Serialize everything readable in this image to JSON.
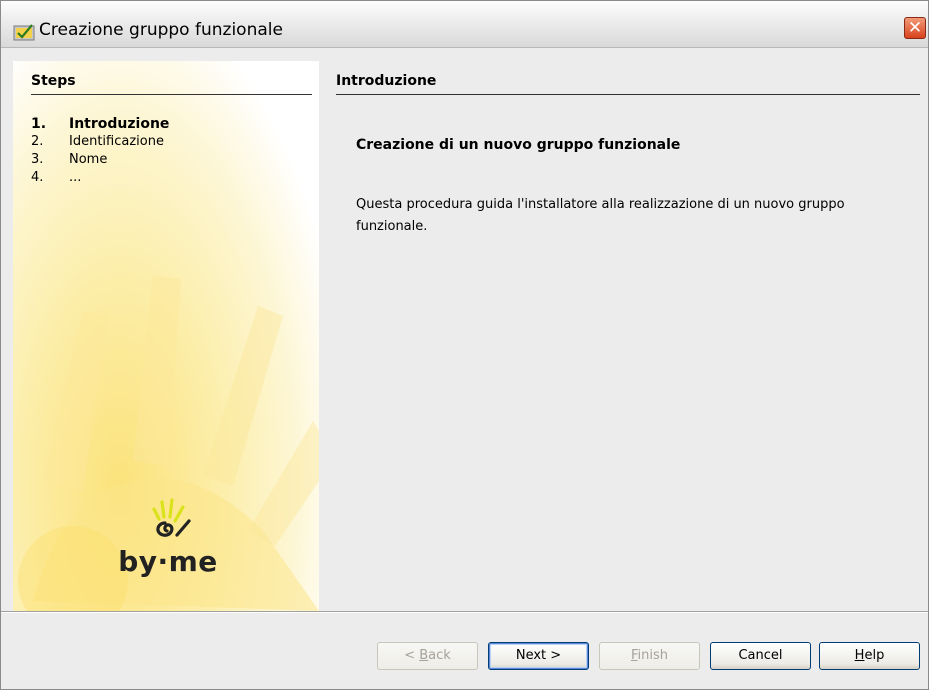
{
  "window": {
    "title": "Creazione gruppo funzionale",
    "close_symbol": "✕"
  },
  "icons": {
    "app": "wizard-app-icon",
    "close": "close-icon",
    "logo": "by-me-logo"
  },
  "steps": {
    "title": "Steps",
    "items": [
      {
        "num": "1.",
        "label": "Introduzione",
        "current": true
      },
      {
        "num": "2.",
        "label": "Identificazione",
        "current": false
      },
      {
        "num": "3.",
        "label": "Nome",
        "current": false
      },
      {
        "num": "4.",
        "label": "...",
        "current": false
      }
    ]
  },
  "logo": {
    "text": "by·me"
  },
  "content": {
    "title": "Introduzione",
    "heading": "Creazione di un nuovo gruppo funzionale",
    "body": "Questa procedura guida l'installatore alla realizzazione di un nuovo gruppo funzionale."
  },
  "buttons": {
    "back": {
      "pre": "< ",
      "mnemonic": "B",
      "rest": "ack"
    },
    "next": {
      "label": "Next >"
    },
    "finish": {
      "pre": "",
      "mnemonic": "F",
      "rest": "inish"
    },
    "cancel": {
      "label": "Cancel"
    },
    "help": {
      "pre": "",
      "mnemonic": "H",
      "rest": "elp"
    }
  },
  "colors": {
    "accent_yellow": "#fbe27a",
    "close_red": "#d9431d",
    "button_border": "#003c74"
  }
}
